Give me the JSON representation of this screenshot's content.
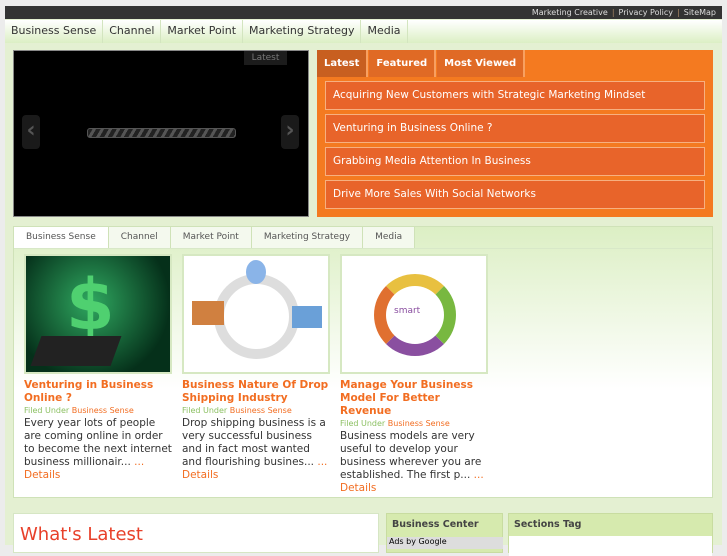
{
  "topbar": {
    "links": [
      "Marketing Creative",
      "Privacy Policy",
      "SiteMap"
    ]
  },
  "nav": [
    "Business Sense",
    "Channel",
    "Market Point",
    "Marketing Strategy",
    "Media"
  ],
  "slider": {
    "label": "Latest"
  },
  "featured": {
    "tabs": [
      "Latest",
      "Featured",
      "Most Viewed"
    ],
    "items": [
      "Acquiring New Customers with Strategic Marketing Mindset",
      "Venturing in Business Online ?",
      "Grabbing Media Attention In Business",
      "Drive More Sales With Social Networks"
    ]
  },
  "category_tabs": [
    "Business Sense",
    "Channel",
    "Market Point",
    "Marketing Strategy",
    "Media"
  ],
  "posts": [
    {
      "title": "Venturing in Business Online ?",
      "filed": "Filed Under",
      "category": "Business Sense",
      "excerpt": "Every year lots of people are coming online in order to become the next internet business millionair...",
      "more": "... Details"
    },
    {
      "title": "Business Nature Of Drop Shipping Industry",
      "filed": "Filed Under",
      "category": "Business Sense",
      "excerpt": "Drop shipping business is a very successful business and in fact most wanted and flourishing busines...",
      "more": "... Details"
    },
    {
      "title": "Manage Your Business Model For Better Revenue",
      "filed": "Filed Under",
      "category": "Business Sense",
      "excerpt": "Business models are very useful to develop your business wherever you are established.  The first p...",
      "more": "... Details"
    }
  ],
  "whats_latest": "What's Latest",
  "business_center": {
    "title": "Business Center",
    "ads": "Ads by Google"
  },
  "sections_tag": "Sections Tag"
}
